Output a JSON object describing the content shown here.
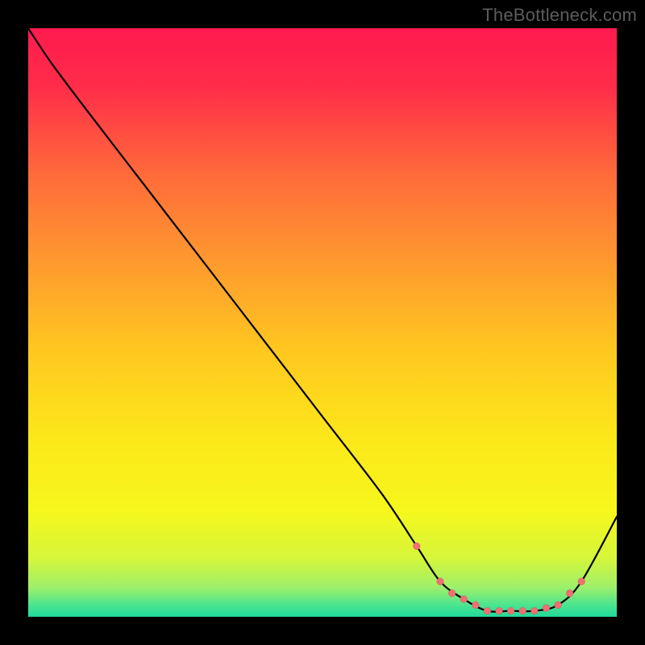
{
  "watermark": "TheBottleneck.com",
  "chart_data": {
    "type": "line",
    "title": "",
    "xlabel": "",
    "ylabel": "",
    "xlim": [
      0,
      100
    ],
    "ylim": [
      0,
      100
    ],
    "series": [
      {
        "name": "bottleneck-curve",
        "x": [
          0,
          4,
          10,
          20,
          30,
          40,
          50,
          60,
          66,
          70,
          74,
          78,
          82,
          86,
          90,
          94,
          100
        ],
        "y": [
          100,
          94,
          86,
          73,
          60,
          47,
          34,
          21,
          12,
          6,
          3,
          1,
          1,
          1,
          2,
          6,
          17
        ]
      }
    ],
    "flat_zone_markers": {
      "name": "optimal-range-dots",
      "x": [
        66,
        70,
        72,
        74,
        76,
        78,
        80,
        82,
        84,
        86,
        88,
        90,
        92,
        94
      ],
      "y": [
        12,
        6,
        4,
        3,
        2,
        1,
        1,
        1,
        1,
        1,
        1.5,
        2,
        4,
        6
      ]
    },
    "gradient": {
      "description": "vertical smooth gradient, red at top through orange, yellow, to green at bottom",
      "stops": [
        {
          "pos": 0.0,
          "color": "#ff1a4f"
        },
        {
          "pos": 0.1,
          "color": "#ff2d49"
        },
        {
          "pos": 0.25,
          "color": "#ff6b3a"
        },
        {
          "pos": 0.4,
          "color": "#ff9a2e"
        },
        {
          "pos": 0.55,
          "color": "#ffc81f"
        },
        {
          "pos": 0.7,
          "color": "#fce81a"
        },
        {
          "pos": 0.82,
          "color": "#f6f71c"
        },
        {
          "pos": 0.9,
          "color": "#d6f63a"
        },
        {
          "pos": 0.95,
          "color": "#9ef06a"
        },
        {
          "pos": 0.98,
          "color": "#4be58f"
        },
        {
          "pos": 1.0,
          "color": "#1fd99a"
        }
      ]
    }
  }
}
